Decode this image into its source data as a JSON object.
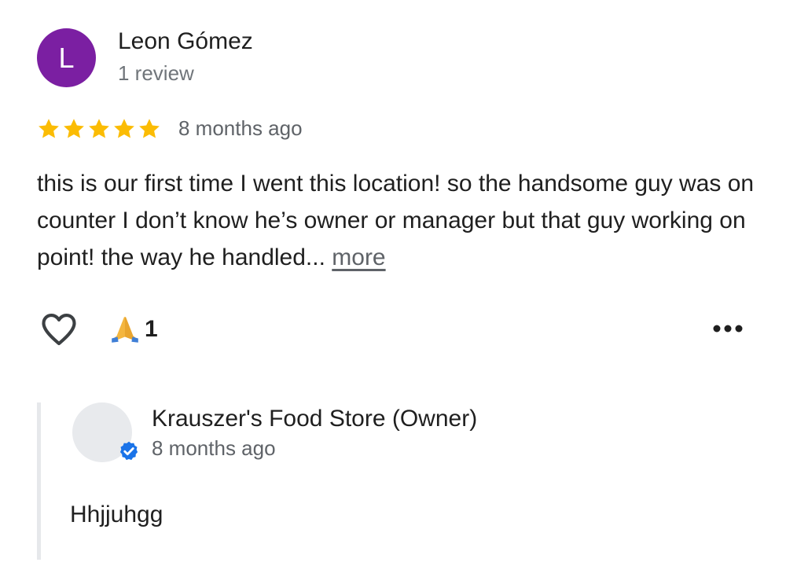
{
  "author": {
    "initial": "L",
    "name": "Leon Gómez",
    "meta": "1 review",
    "avatar_color": "#7b1fa2"
  },
  "review": {
    "rating": 5,
    "rating_max": 5,
    "date": "8 months ago",
    "text": "this is our first time I went this location! so the handsome guy was on counter I don’t know he’s owner or manager but that guy working on point! the way he handled... ",
    "more_label": "more",
    "star_color": "#fbbc04"
  },
  "actions": {
    "like_icon": "heart-outline-icon",
    "reaction_icon": "folded-hands-emoji",
    "reaction_count": "1",
    "more_options_icon": "more-horizontal-icon"
  },
  "owner_reply": {
    "name": "Krauszer's Food Store (Owner)",
    "date": "8 months ago",
    "text": "Hhjjuhgg",
    "verified_icon": "verified-badge-icon",
    "badge_color": "#1a73e8"
  }
}
